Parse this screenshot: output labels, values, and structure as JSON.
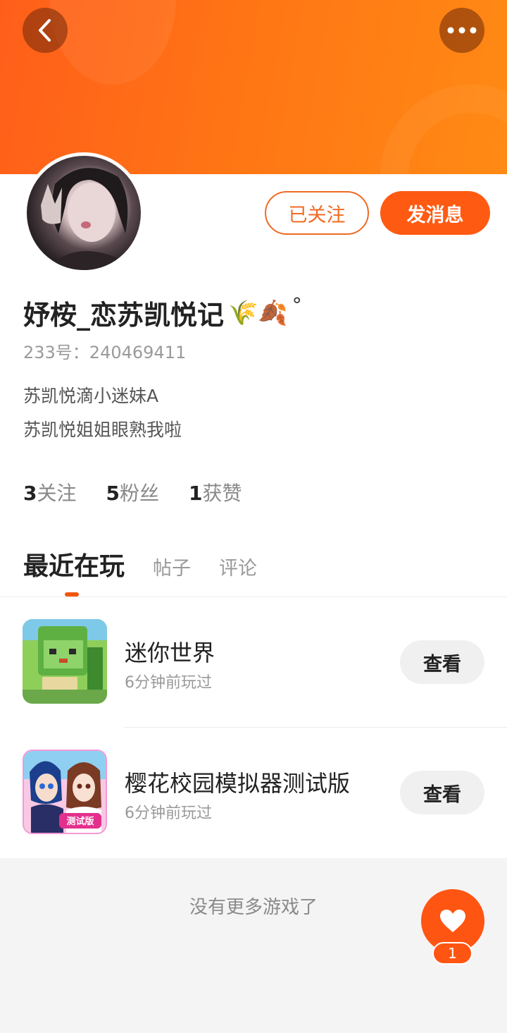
{
  "header": {
    "back_icon": "chevron-left-icon",
    "more_icon": "more-horizontal-icon",
    "gradient_start": "#ff5e1a",
    "gradient_end": "#ff8a14"
  },
  "profile": {
    "nickname": "妤桉_恋苏凯悦记",
    "nickname_emojis": "🌾🍂",
    "nickname_suffix": "°",
    "id_line": "233号：240469411",
    "bio_lines": [
      "苏凯悦滴小迷妹A",
      "苏凯悦姐姐眼熟我啦"
    ],
    "follow_label": "已关注",
    "message_label": "发消息"
  },
  "stats": [
    {
      "value": "3",
      "label": "关注"
    },
    {
      "value": "5",
      "label": "粉丝"
    },
    {
      "value": "1",
      "label": "获赞"
    }
  ],
  "tabs": [
    {
      "label": "最近在玩",
      "active": true
    },
    {
      "label": "帖子",
      "active": false
    },
    {
      "label": "评论",
      "active": false
    }
  ],
  "games": [
    {
      "title": "迷你世界",
      "subtitle": "6分钟前玩过",
      "action": "查看"
    },
    {
      "title": "樱花校园模拟器测试版",
      "subtitle": "6分钟前玩过",
      "action": "查看",
      "icon_tag": "测试版"
    }
  ],
  "footer": {
    "no_more": "没有更多游戏了"
  },
  "like": {
    "icon": "heart-icon",
    "count": "1"
  },
  "colors": {
    "accent": "#ff5a12",
    "follow_border": "#f06a24"
  }
}
